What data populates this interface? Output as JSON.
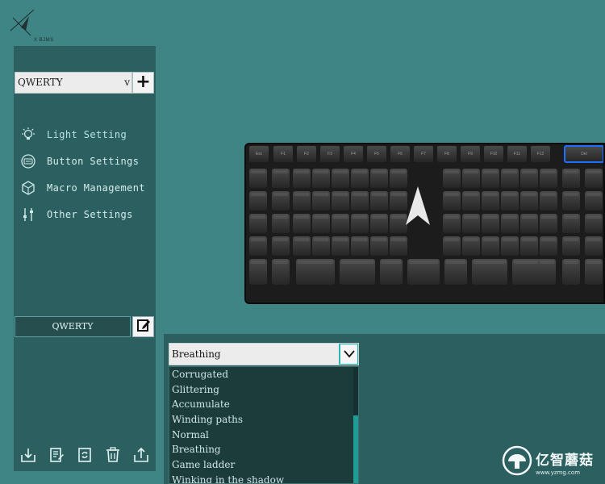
{
  "brand": {
    "logo_text": "X BJMS"
  },
  "sidebar": {
    "profile_select": {
      "value": "QWERTY",
      "chevron": "v"
    },
    "add_button": "+",
    "menu": [
      {
        "label": "Light Setting",
        "icon": "bulb-icon"
      },
      {
        "label": "Button Settings",
        "icon": "keyboard-key-icon"
      },
      {
        "label": "Macro Management",
        "icon": "cube-icon"
      },
      {
        "label": "Other Settings",
        "icon": "sliders-icon"
      }
    ],
    "profile_name": "QWERTY",
    "toolbar": [
      "import-icon",
      "document-edit-icon",
      "refresh-icon",
      "trash-icon",
      "export-icon"
    ]
  },
  "keyboard": {
    "fn_row": [
      "Esc",
      "F1",
      "F2",
      "F3",
      "F4",
      "F5",
      "F6",
      "F7",
      "F8",
      "F9",
      "F10",
      "F11",
      "F12",
      "Del"
    ],
    "highlight_color": "#1e6fff"
  },
  "lighting": {
    "selected_effect": "Breathing",
    "options": [
      "Corrugated",
      "Glittering",
      "Accumulate",
      "Winding paths",
      "Normal",
      "Breathing",
      "Game ladder",
      "Winking in the shadow"
    ]
  },
  "watermark": {
    "cn": "亿智蘑菇",
    "url": "www.yzmg.com"
  },
  "colors": {
    "background": "#3f8585",
    "panel": "#2c6060",
    "scroll_thumb": "#1d9d95"
  }
}
